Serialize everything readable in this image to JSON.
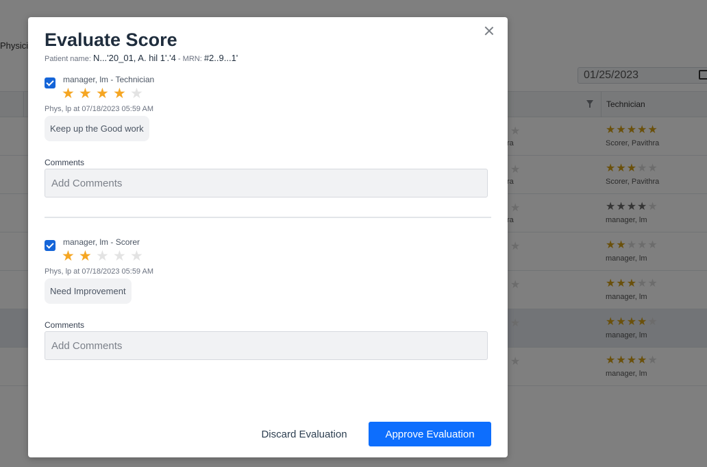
{
  "background": {
    "physician_label": "Physici",
    "date_value": "01/25/2023",
    "technician_column": "Technician",
    "rows": [
      {
        "stars": 5,
        "stars_color": "gold",
        "name": "Scorer, Pavithra",
        "partial": "ra"
      },
      {
        "stars": 3,
        "stars_color": "gold",
        "name": "Scorer, Pavithra",
        "partial": "ra"
      },
      {
        "stars": 4,
        "stars_color": "gray",
        "name": "manager, lm",
        "partial": "ra"
      },
      {
        "stars": 2,
        "stars_color": "gold",
        "name": "manager, lm",
        "partial": ""
      },
      {
        "stars": 3,
        "stars_color": "gold",
        "name": "manager, lm",
        "partial": ""
      },
      {
        "stars": 4,
        "stars_color": "gold",
        "name": "manager, lm",
        "partial": "",
        "selected": true
      },
      {
        "stars": 4,
        "stars_color": "gold",
        "name": "manager, lm",
        "partial": ""
      }
    ]
  },
  "modal": {
    "title": "Evaluate Score",
    "patient_label": "Patient name:",
    "patient_name": "N...'20_01, A. hil 1'.'4",
    "mrn_label": "MRN:",
    "mrn_value": "#2..9...1'",
    "evaluations": [
      {
        "reviewer": "manager, lm - Technician",
        "checked": true,
        "rating": 4,
        "max_rating": 5,
        "meta": "Phys, lp at 07/18/2023 05:59 AM",
        "feedback": "Keep up the Good work",
        "comments_label": "Comments",
        "comments_placeholder": "Add Comments"
      },
      {
        "reviewer": "manager, lm - Scorer",
        "checked": true,
        "rating": 2,
        "max_rating": 5,
        "meta": "Phys, lp at 07/18/2023 05:59 AM",
        "feedback": "Need Improvement",
        "comments_label": "Comments",
        "comments_placeholder": "Add Comments"
      }
    ],
    "discard_label": "Discard Evaluation",
    "approve_label": "Approve Evaluation"
  },
  "colors": {
    "star_on": "#f5a623",
    "star_off": "#e3e3e3",
    "primary": "#0d6efd",
    "checkbox": "#1565d8"
  },
  "icons": [
    "close-icon",
    "checkbox-checked-icon",
    "star-icon",
    "calendar-icon",
    "filter-icon"
  ]
}
